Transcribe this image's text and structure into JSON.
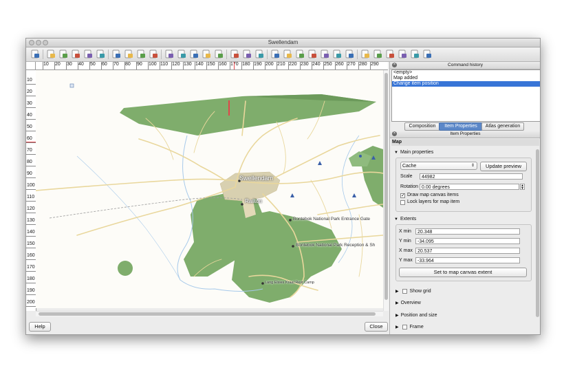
{
  "window": {
    "title": "Swellendam"
  },
  "toolbar": {
    "icons": [
      "save-icon",
      "new-composer-icon",
      "duplicate-composer-icon",
      "composer-manager-icon",
      "open-template-icon",
      "save-template-icon",
      "print-icon",
      "export-image-icon",
      "export-svg-icon",
      "export-pdf-icon",
      "undo-icon",
      "redo-icon",
      "zoom-full-icon",
      "zoom-in-icon",
      "zoom-out-icon",
      "refresh-icon",
      "add-map-icon",
      "add-image-icon",
      "add-label-icon",
      "add-legend-icon",
      "add-scalebar-icon",
      "add-shape-icon",
      "add-arrow-icon",
      "add-table-icon",
      "add-html-icon",
      "select-move-icon",
      "move-content-icon",
      "group-icon",
      "ungroup-icon",
      "lock-icon",
      "align-icon"
    ]
  },
  "ruler": {
    "horizontal": [
      "10",
      "20",
      "30",
      "40",
      "50",
      "60",
      "70",
      "80",
      "90",
      "100",
      "110",
      "120",
      "130",
      "140",
      "150",
      "160",
      "170",
      "180",
      "190",
      "200",
      "210",
      "220",
      "230",
      "240",
      "250",
      "260",
      "270",
      "280",
      "290"
    ],
    "vertical": [
      "10",
      "20",
      "30",
      "40",
      "50",
      "60",
      "70",
      "80",
      "90",
      "100",
      "110",
      "120",
      "130",
      "140",
      "150",
      "160",
      "170",
      "180",
      "190",
      "200"
    ]
  },
  "map": {
    "labels": {
      "town": "Swellendam",
      "railton": "Railton",
      "gate": "Bontebok National Park Entrance Gate",
      "reception": "Bontebok National Park Reception & Sh",
      "camp": "Lang Elsies Kraal Rest Camp"
    },
    "colors": {
      "park": "#7fad6c",
      "road": "#e9d79c",
      "water": "#a6c9ea",
      "urban": "#e3d9b8"
    }
  },
  "footer": {
    "help_label": "Help",
    "close_label": "Close"
  },
  "command_history": {
    "title": "Command history",
    "items": [
      "<empty>",
      "Map added",
      "Change item position"
    ],
    "selected_index": 2
  },
  "tabs": {
    "composition": "Composition",
    "item_properties": "Item Properties",
    "atlas": "Atlas generation",
    "active": "Item Properties"
  },
  "item_properties": {
    "title": "Item Properties",
    "section": "Map",
    "main_properties": {
      "header": "Main properties",
      "preview_mode": "Cache",
      "update_preview_label": "Update preview",
      "scale_label": "Scale",
      "scale_value": "44982",
      "rotation_label": "Rotation",
      "rotation_value": "0.00 degrees",
      "draw_canvas_items_label": "Draw map canvas items",
      "draw_canvas_items_checked": true,
      "lock_layers_label": "Lock layers for map item",
      "lock_layers_checked": false
    },
    "extents": {
      "header": "Extents",
      "xmin_label": "X min",
      "xmin_value": "20.348",
      "ymin_label": "Y min",
      "ymin_value": "-34.095",
      "xmax_label": "X max",
      "xmax_value": "20.537",
      "ymax_label": "Y max",
      "ymax_value": "-33.964",
      "set_extent_label": "Set to map canvas extent"
    },
    "collapsed": {
      "show_grid": "Show grid",
      "overview": "Overview",
      "position_size": "Position and size",
      "frame": "Frame"
    }
  }
}
